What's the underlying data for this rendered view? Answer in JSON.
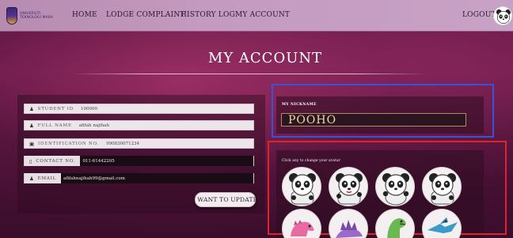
{
  "nav": {
    "logo_text": "UNIVERSITI TEKNOLOGI MARA",
    "links": [
      "HOME",
      "LODGE COMPLAINT",
      "HISTORY LOG",
      "MY ACCOUNT"
    ],
    "logout": "LOGOUT",
    "avatar_icon": "panda-avatar-icon"
  },
  "page": {
    "title": "MY ACCOUNT"
  },
  "profile": {
    "fields": [
      {
        "icon": "user-icon",
        "label": "STUDENT ID",
        "value": "100000"
      },
      {
        "icon": "user-icon",
        "label": "FULL NAME",
        "value": "afifah najihah"
      },
      {
        "icon": "id-card-icon",
        "label": "IDENTIFICATION NO.",
        "value": "990830071234"
      },
      {
        "icon": "phone-icon",
        "label": "CONTACT NO.",
        "value": "011-61442205"
      },
      {
        "icon": "user-icon",
        "label": "EMAIL",
        "value": "afifahnajihah99@gmail.com"
      }
    ],
    "update_button": "I WANT TO UPDATE"
  },
  "nickname": {
    "label": "MY NICKNAME",
    "value": "POOHO"
  },
  "avatars": {
    "hint": "Click any to change your avatar",
    "options": [
      {
        "icon": "panda-avatar-1-icon"
      },
      {
        "icon": "panda-avatar-2-icon"
      },
      {
        "icon": "panda-avatar-3-icon"
      },
      {
        "icon": "panda-avatar-4-icon"
      },
      {
        "icon": "pink-dinosaur-avatar-icon"
      },
      {
        "icon": "purple-stegosaurus-avatar-icon"
      },
      {
        "icon": "green-dinosaur-avatar-icon"
      },
      {
        "icon": "blue-pterodactyl-avatar-icon"
      }
    ]
  },
  "colors": {
    "background": "#5a1540",
    "navbar": "#c49ac0",
    "nickname_outline": "#3a52d8",
    "avatar_outline": "#e0222a",
    "nickname_text": "#f0d7a0"
  }
}
